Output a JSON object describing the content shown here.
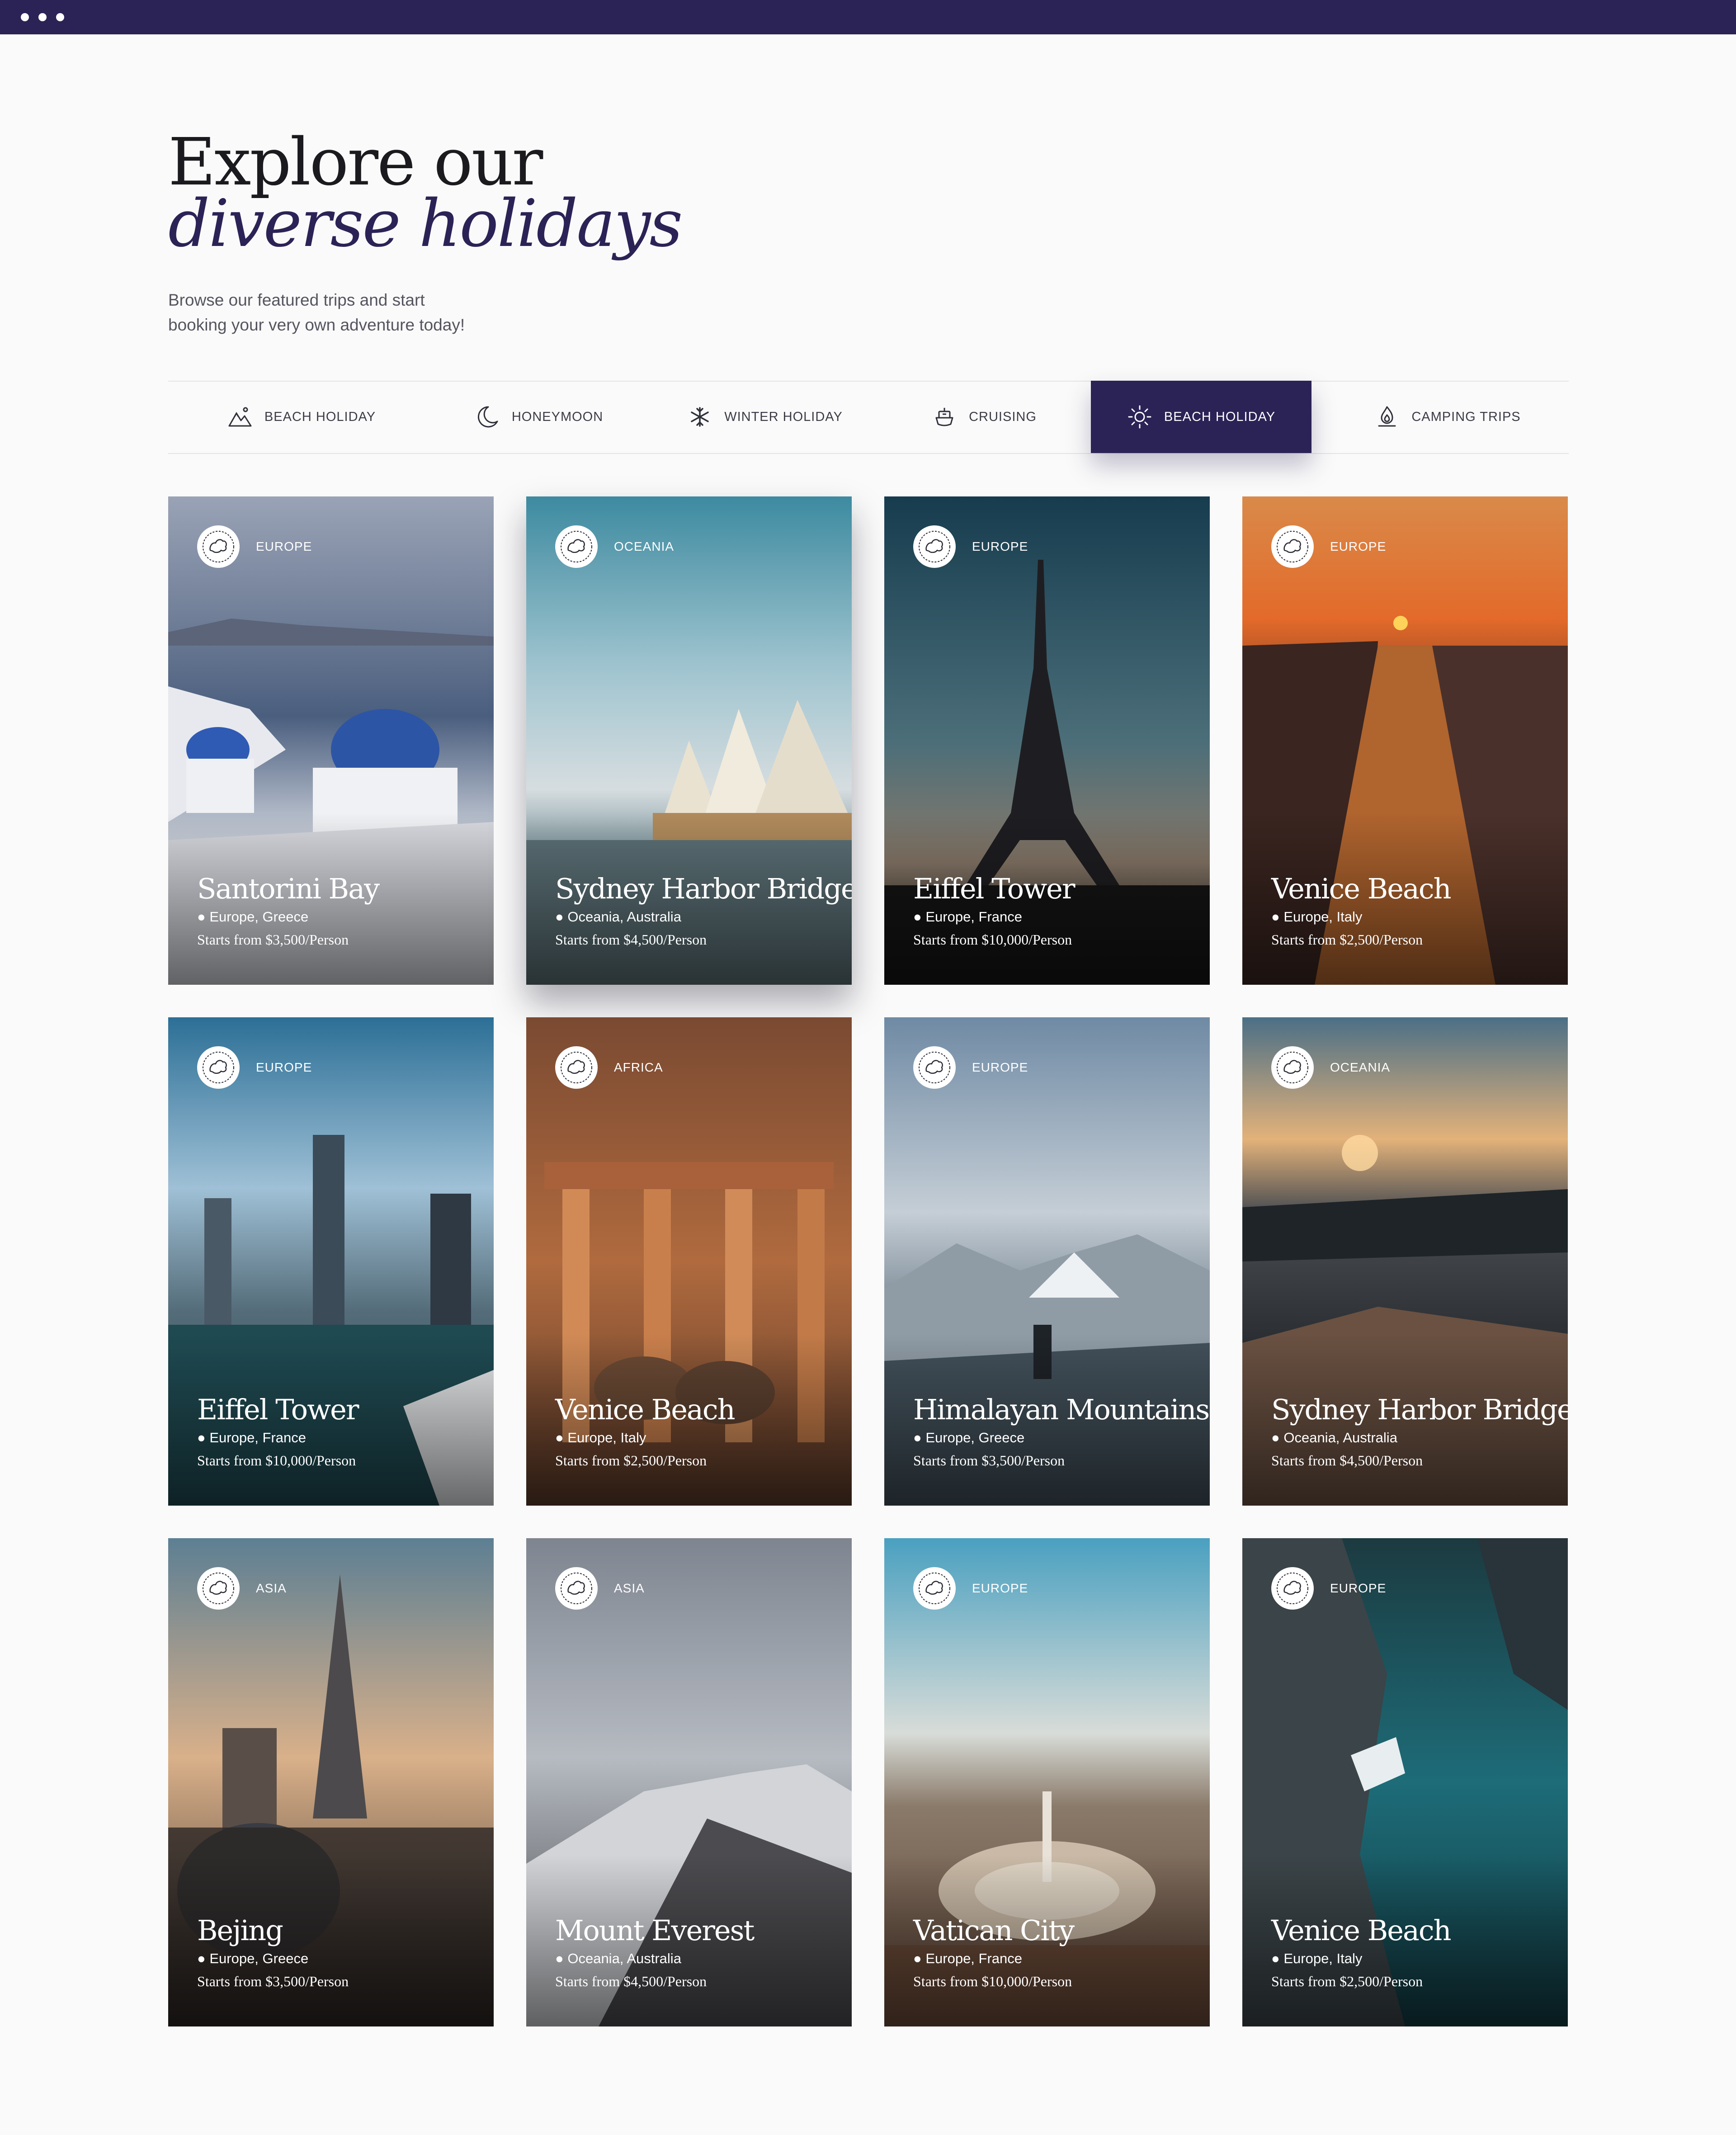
{
  "hero": {
    "title_line1": "Explore our",
    "title_line2": "diverse holidays",
    "subtitle_line1": "Browse our featured trips and start",
    "subtitle_line2": "booking your very own adventure today!"
  },
  "tabs": [
    {
      "label": "BEACH HOLIDAY",
      "icon": "mountain-icon",
      "active": false
    },
    {
      "label": "HONEYMOON",
      "icon": "moon-icon",
      "active": false
    },
    {
      "label": "WINTER HOLIDAY",
      "icon": "snowflake-icon",
      "active": false
    },
    {
      "label": "CRUISING",
      "icon": "ship-icon",
      "active": false
    },
    {
      "label": "BEACH HOLIDAY",
      "icon": "sun-icon",
      "active": true
    },
    {
      "label": "CAMPING TRIPS",
      "icon": "campfire-icon",
      "active": false
    }
  ],
  "cards": [
    {
      "region": "EUROPE",
      "name": "Santorini Bay",
      "location": "Europe, Greece",
      "price": "Starts from $3,500/Person",
      "icon": "globe-europe-icon"
    },
    {
      "region": "OCEANIA",
      "name": "Sydney Harbor Bridge",
      "location": "Oceania, Australia",
      "price": "Starts from $4,500/Person",
      "icon": "globe-oceania-icon"
    },
    {
      "region": "EUROPE",
      "name": "Eiffel Tower",
      "location": "Europe, France",
      "price": "Starts from $10,000/Person",
      "icon": "globe-europe-icon"
    },
    {
      "region": "EUROPE",
      "name": "Venice Beach",
      "location": "Europe, Italy",
      "price": "Starts from $2,500/Person",
      "icon": "globe-europe-icon"
    },
    {
      "region": "EUROPE",
      "name": "Eiffel Tower",
      "location": "Europe, France",
      "price": "Starts from $10,000/Person",
      "icon": "globe-europe-icon"
    },
    {
      "region": "AFRICA",
      "name": "Venice Beach",
      "location": "Europe, Italy",
      "price": "Starts from $2,500/Person",
      "icon": "globe-africa-icon"
    },
    {
      "region": "EUROPE",
      "name": "Himalayan Mountains",
      "location": "Europe, Greece",
      "price": "Starts from $3,500/Person",
      "icon": "globe-europe-icon"
    },
    {
      "region": "OCEANIA",
      "name": "Sydney Harbor Bridge",
      "location": "Oceania, Australia",
      "price": "Starts from $4,500/Person",
      "icon": "globe-oceania-icon"
    },
    {
      "region": "ASIA",
      "name": "Bejing",
      "location": "Europe, Greece",
      "price": "Starts from $3,500/Person",
      "icon": "globe-asia-icon"
    },
    {
      "region": "ASIA",
      "name": "Mount Everest",
      "location": "Oceania, Australia",
      "price": "Starts from $4,500/Person",
      "icon": "globe-asia-icon"
    },
    {
      "region": "EUROPE",
      "name": "Vatican City",
      "location": "Europe, France",
      "price": "Starts from $10,000/Person",
      "icon": "globe-europe-icon"
    },
    {
      "region": "EUROPE",
      "name": "Venice Beach",
      "location": "Europe, Italy",
      "price": "Starts from $2,500/Person",
      "icon": "globe-europe-icon"
    }
  ],
  "colors": {
    "brand": "#2b2356",
    "background": "#fafafa",
    "text_dark": "#1a1a1f",
    "divider": "#e4e4e8"
  }
}
